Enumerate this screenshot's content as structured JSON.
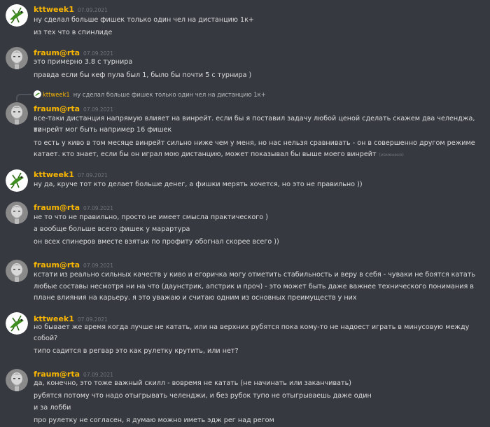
{
  "messages": [
    {
      "author": "kttweek1",
      "avatar_icon": "grasshopper-avatar-icon",
      "timestamp": "07.09.2021",
      "lines": [
        "ну сделал больше фишек только один чел на дистанцию 1к+",
        "из тех что в спинлиде"
      ]
    },
    {
      "author": "fraum@rta",
      "avatar_icon": "statue-avatar-icon",
      "timestamp": "07.09.2021",
      "lines": [
        "это примерно 3.8 с турнира",
        "правда если бы кеф пула был 1, было бы почти 5 с турнира )"
      ]
    },
    {
      "author": "fraum@rta",
      "avatar_icon": "statue-avatar-icon",
      "timestamp": "07.09.2021",
      "reply": {
        "author": "kttweek1",
        "text": "ну сделал больше фишек только один чел на дистанцию 1к+"
      },
      "lines": [
        "все-таки дистанция напрямую влияет на винрейт. если бы я поставил задачу любой ценой сделать скажем два челенджа, то",
        "винрейт мог быть например 16 фишек",
        "то есть у киво в том месяце винрейт сильно ниже чем у меня, но нас нельзя сравнивать - он в совершенно другом режиме",
        "катает. кто знает, если бы он играл мою дистанцию, может показывал бы выше моего винрейт"
      ],
      "edited_label": "(изменено)"
    },
    {
      "author": "kttweek1",
      "avatar_icon": "grasshopper-avatar-icon",
      "timestamp": "07.09.2021",
      "lines": [
        "ну да, круче тот кто делает больше денег, а фишки мерять хочется, но это не правильно ))"
      ]
    },
    {
      "author": "fraum@rta",
      "avatar_icon": "statue-avatar-icon",
      "timestamp": "07.09.2021",
      "lines": [
        "не то что не правильно, просто не имеет смысла практического )",
        "а вообще больше всего фишек у марартура",
        "он всех спинеров вместе взятых по профиту обогнал скорее всего ))"
      ]
    },
    {
      "author": "fraum@rta",
      "avatar_icon": "statue-avatar-icon",
      "timestamp": "07.09.2021",
      "lines": [
        "кстати из реально сильных качеств у киво и егоричка могу отметить стабильность и веру в себя - чуваки не боятся катать",
        "любые составы несмотря ни на что (даунстрик, апстрик и проч) - это может быть даже важнее технического понимания в",
        "плане влияния на карьеру. я это уважаю и считаю одним из основных преимуществ у них"
      ]
    },
    {
      "author": "kttweek1",
      "avatar_icon": "grasshopper-avatar-icon",
      "timestamp": "07.09.2021",
      "lines": [
        "но бывает же время когда лучше не катать, или на верхних рубятся пока кому-то не надоест играть в минусовую между",
        "собой?",
        "типо садится в регвар это как рулетку крутить, или нет?"
      ]
    },
    {
      "author": "fraum@rta",
      "avatar_icon": "statue-avatar-icon",
      "timestamp": "07.09.2021",
      "lines": [
        "да, конечно, это тоже важный скилл - вовремя не катать (не начинать или заканчивать)",
        "рубятся потому что надо отыгрывать челенджи, и без рубок тупо не отыгрываешь даже один",
        "и за лобби",
        "про рулетку не согласен, я думаю можно иметь эдж рег над регом"
      ]
    }
  ],
  "colors": {
    "background": "#36393f",
    "username": "#fab702",
    "text": "#dcddde",
    "timestamp": "#72767d"
  }
}
